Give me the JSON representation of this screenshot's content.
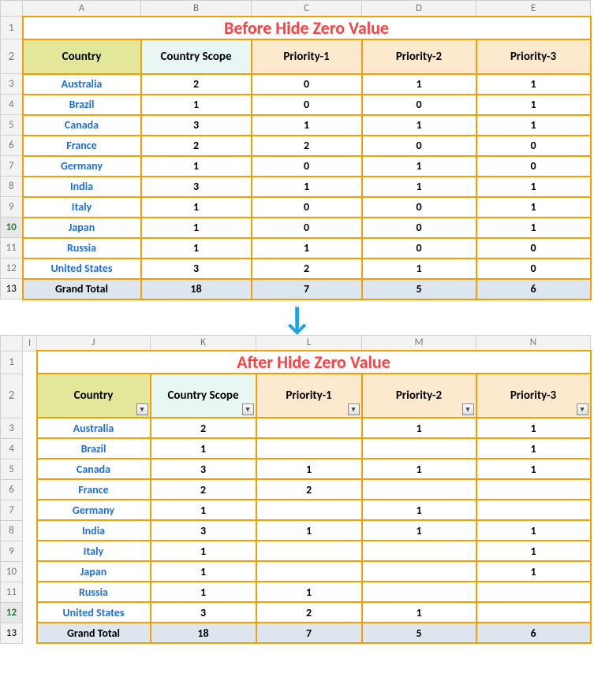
{
  "before": {
    "title": "Before Hide Zero Value",
    "cols": [
      "A",
      "B",
      "C",
      "D",
      "E"
    ],
    "rows": [
      "1",
      "2",
      "3",
      "4",
      "5",
      "6",
      "7",
      "8",
      "9",
      "10",
      "11",
      "12",
      "13"
    ],
    "selectedRow": "10",
    "headers": {
      "country": "Country",
      "scope": "Country Scope",
      "p1": "Priority-1",
      "p2": "Priority-2",
      "p3": "Priority-3"
    },
    "data": [
      {
        "country": "Australia",
        "scope": "2",
        "p1": "0",
        "p2": "1",
        "p3": "1"
      },
      {
        "country": "Brazil",
        "scope": "1",
        "p1": "0",
        "p2": "0",
        "p3": "1"
      },
      {
        "country": "Canada",
        "scope": "3",
        "p1": "1",
        "p2": "1",
        "p3": "1"
      },
      {
        "country": "France",
        "scope": "2",
        "p1": "2",
        "p2": "0",
        "p3": "0"
      },
      {
        "country": "Germany",
        "scope": "1",
        "p1": "0",
        "p2": "1",
        "p3": "0"
      },
      {
        "country": "India",
        "scope": "3",
        "p1": "1",
        "p2": "1",
        "p3": "1"
      },
      {
        "country": "Italy",
        "scope": "1",
        "p1": "0",
        "p2": "0",
        "p3": "1"
      },
      {
        "country": "Japan",
        "scope": "1",
        "p1": "0",
        "p2": "0",
        "p3": "1"
      },
      {
        "country": "Russia",
        "scope": "1",
        "p1": "1",
        "p2": "0",
        "p3": "0"
      },
      {
        "country": "United States",
        "scope": "3",
        "p1": "2",
        "p2": "1",
        "p3": "0"
      }
    ],
    "total": {
      "label": "Grand Total",
      "scope": "18",
      "p1": "7",
      "p2": "5",
      "p3": "6"
    }
  },
  "after": {
    "title": "After Hide Zero Value",
    "cols": [
      "I",
      "J",
      "K",
      "L",
      "M",
      "N"
    ],
    "rows": [
      "1",
      "2",
      "3",
      "4",
      "5",
      "6",
      "7",
      "8",
      "9",
      "10",
      "11",
      "12",
      "13"
    ],
    "selectedRow": "12",
    "headers": {
      "country": "Country",
      "scope": "Country Scope",
      "p1": "Priority-1",
      "p2": "Priority-2",
      "p3": "Priority-3"
    },
    "data": [
      {
        "country": "Australia",
        "scope": "2",
        "p1": "",
        "p2": "1",
        "p3": "1"
      },
      {
        "country": "Brazil",
        "scope": "1",
        "p1": "",
        "p2": "",
        "p3": "1"
      },
      {
        "country": "Canada",
        "scope": "3",
        "p1": "1",
        "p2": "1",
        "p3": "1"
      },
      {
        "country": "France",
        "scope": "2",
        "p1": "2",
        "p2": "",
        "p3": ""
      },
      {
        "country": "Germany",
        "scope": "1",
        "p1": "",
        "p2": "1",
        "p3": ""
      },
      {
        "country": "India",
        "scope": "3",
        "p1": "1",
        "p2": "1",
        "p3": "1"
      },
      {
        "country": "Italy",
        "scope": "1",
        "p1": "",
        "p2": "",
        "p3": "1"
      },
      {
        "country": "Japan",
        "scope": "1",
        "p1": "",
        "p2": "",
        "p3": "1"
      },
      {
        "country": "Russia",
        "scope": "1",
        "p1": "1",
        "p2": "",
        "p3": ""
      },
      {
        "country": "United States",
        "scope": "3",
        "p1": "2",
        "p2": "1",
        "p3": ""
      }
    ],
    "total": {
      "label": "Grand Total",
      "scope": "18",
      "p1": "7",
      "p2": "5",
      "p3": "6"
    }
  },
  "filterGlyph": "▾"
}
